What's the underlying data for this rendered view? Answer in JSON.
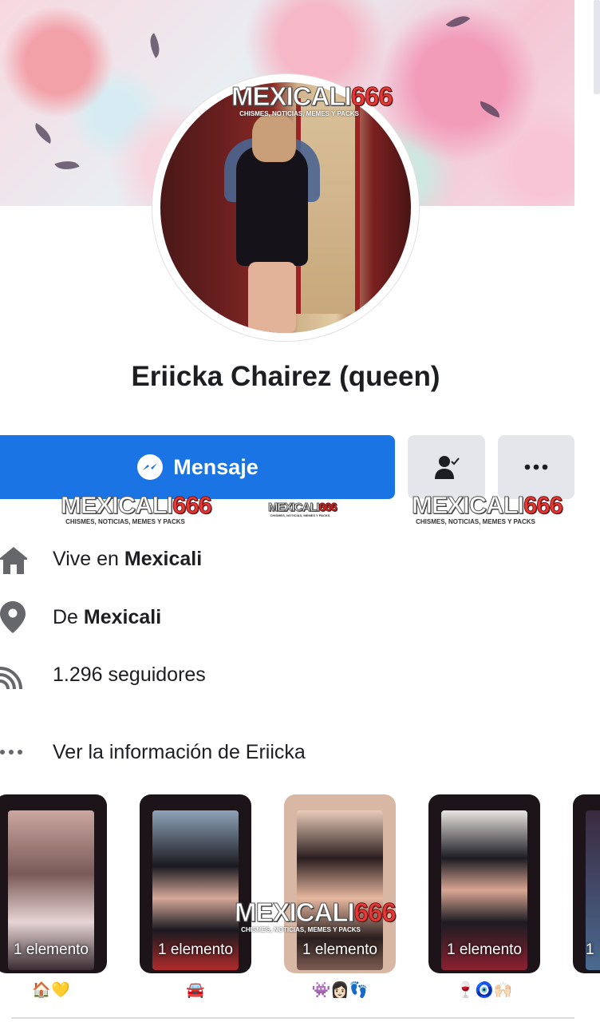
{
  "profile": {
    "name": "Eriicka Chairez (queen)"
  },
  "watermark": {
    "brand": "MEXICALI",
    "number": "666",
    "tagline": "CHISMES, NOTICIAS, MEMES Y PACKS"
  },
  "actions": {
    "message_label": "Mensaje",
    "friend_icon": "person-check-icon",
    "more_icon": "ellipsis-icon"
  },
  "info": {
    "lives_prefix": "Vive en ",
    "lives_city": "Mexicali",
    "from_prefix": "De ",
    "from_city": "Mexicali",
    "followers": "1.296 seguidores",
    "see_info": "Ver la información de Eriicka"
  },
  "highlights": [
    {
      "label": "1 elemento",
      "emoji": "🏠💛"
    },
    {
      "label": "1 elemento",
      "emoji": "🚘"
    },
    {
      "label": "1 elemento",
      "emoji": "👾👩🏻👣"
    },
    {
      "label": "1 elemento",
      "emoji": "🍷🧿🙌🏻"
    },
    {
      "label": "1"
    }
  ],
  "colors": {
    "primary_blue": "#1b74e4",
    "secondary_gray": "#e4e6eb",
    "text": "#1c1e21",
    "watermark_red": "#e53935"
  }
}
